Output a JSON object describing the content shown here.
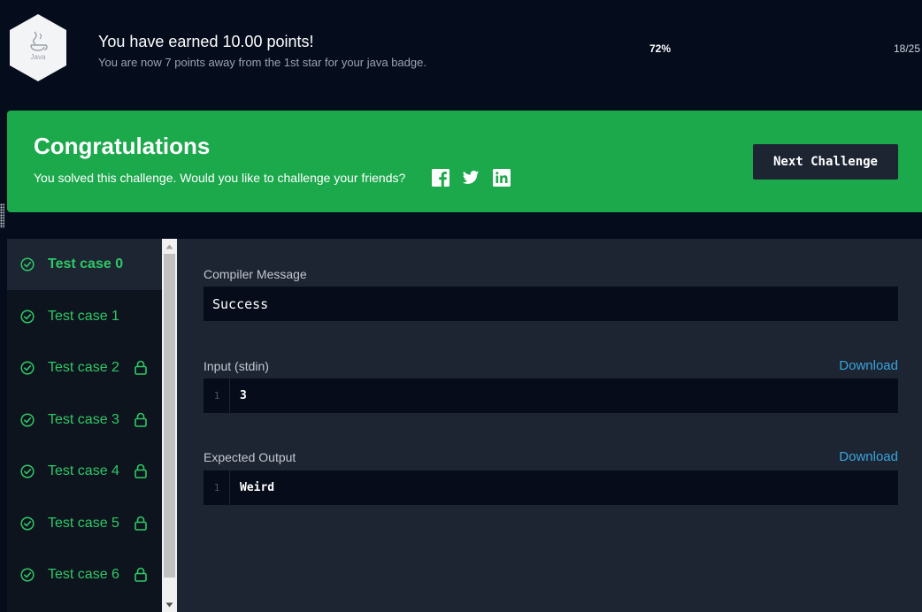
{
  "header": {
    "badge_label": "Java",
    "earned_title": "You have earned 10.00 points!",
    "earned_sub": "You are now 7 points away from the 1st star for your java badge.",
    "progress_percent": "72%",
    "progress_count": "18/25"
  },
  "banner": {
    "title": "Congratulations",
    "subtitle": "You solved this challenge. Would you like to challenge your friends?",
    "next_button": "Next Challenge",
    "social_icons": [
      "facebook-icon",
      "twitter-icon",
      "linkedin-icon"
    ]
  },
  "test_cases": [
    {
      "label": "Test case 0",
      "locked": false,
      "active": true
    },
    {
      "label": "Test case 1",
      "locked": false,
      "active": false
    },
    {
      "label": "Test case 2",
      "locked": true,
      "active": false
    },
    {
      "label": "Test case 3",
      "locked": true,
      "active": false
    },
    {
      "label": "Test case 4",
      "locked": true,
      "active": false
    },
    {
      "label": "Test case 5",
      "locked": true,
      "active": false
    },
    {
      "label": "Test case 6",
      "locked": true,
      "active": false
    }
  ],
  "output": {
    "compiler_label": "Compiler Message",
    "compiler_message": "Success",
    "input_label": "Input (stdin)",
    "input_download": "Download",
    "input_line_num": "1",
    "input_value": "3",
    "expected_label": "Expected Output",
    "expected_download": "Download",
    "expected_line_num": "1",
    "expected_value": "Weird"
  },
  "colors": {
    "background": "#050c1c",
    "banner_green": "#1ba94c",
    "success_green": "#2ec866",
    "panel": "#1d2432",
    "link_blue": "#39a6dc"
  }
}
